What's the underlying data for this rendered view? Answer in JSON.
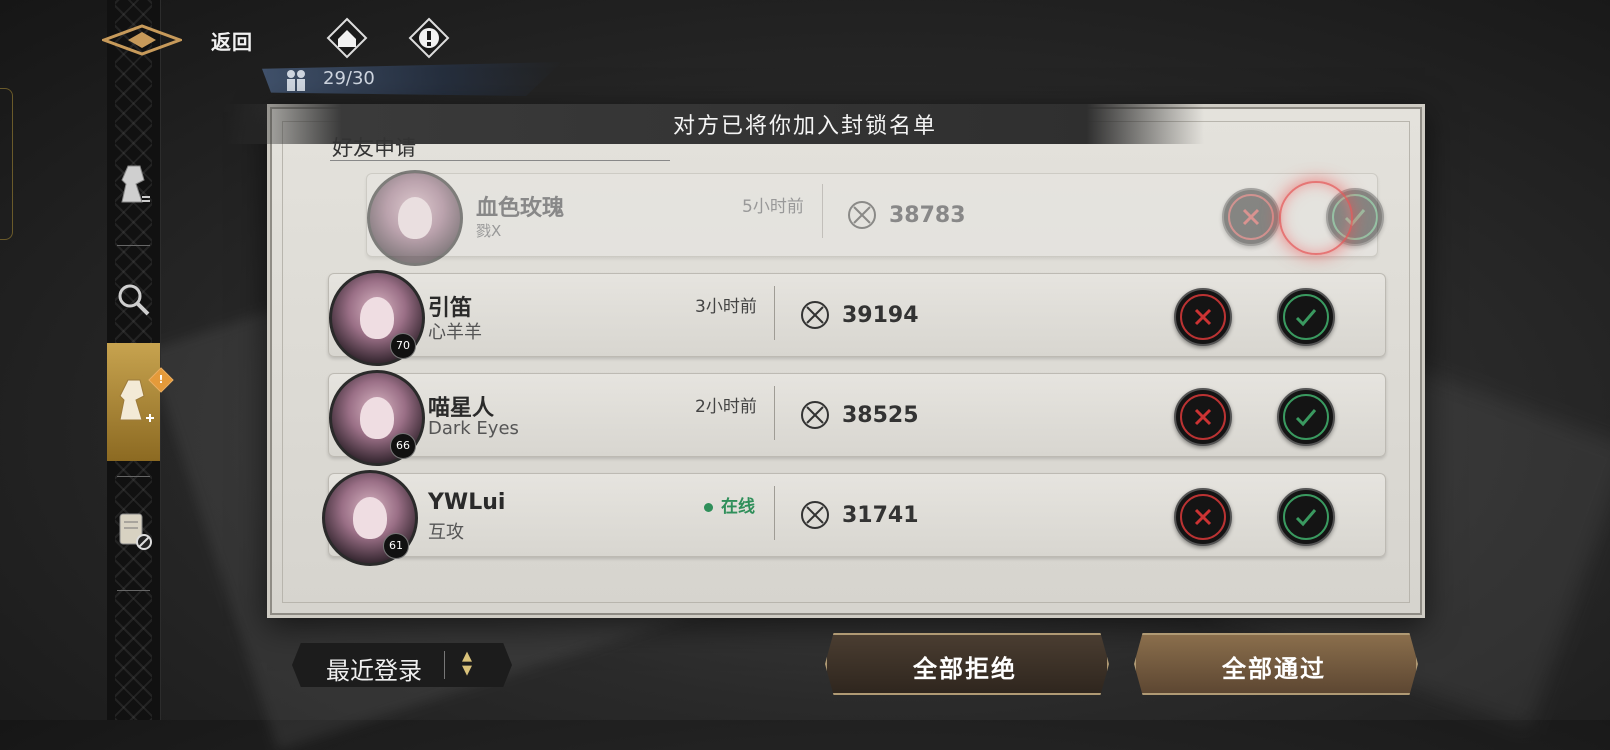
{
  "header": {
    "back_label": "返回",
    "friend_count": "29/30"
  },
  "panel": {
    "title": "对方已将你加入封锁名单",
    "section_label": "好友申请"
  },
  "requests": [
    {
      "name": "血色玫瑰",
      "sub": "戮X",
      "status": "5小时前",
      "power": "38783",
      "level": "",
      "faded": true
    },
    {
      "name": "引笛",
      "sub": "心羊羊",
      "status": "3小时前",
      "power": "39194",
      "level": "70",
      "faded": false
    },
    {
      "name": "喵星人",
      "sub": "Dark Eyes",
      "status": "2小时前",
      "power": "38525",
      "level": "66",
      "faded": false
    },
    {
      "name": "YWLui",
      "sub": "互攻",
      "status": "在线",
      "power": "31741",
      "level": "61",
      "faded": false,
      "online": true
    }
  ],
  "footer": {
    "sort_label": "最近登录",
    "reject_all": "全部拒绝",
    "accept_all": "全部通过"
  },
  "rail": {
    "badge": "!"
  },
  "colors": {
    "reject": "#b33333",
    "accept": "#3a9a60",
    "online": "#2f8f5a",
    "gold": "#c7a34f"
  }
}
